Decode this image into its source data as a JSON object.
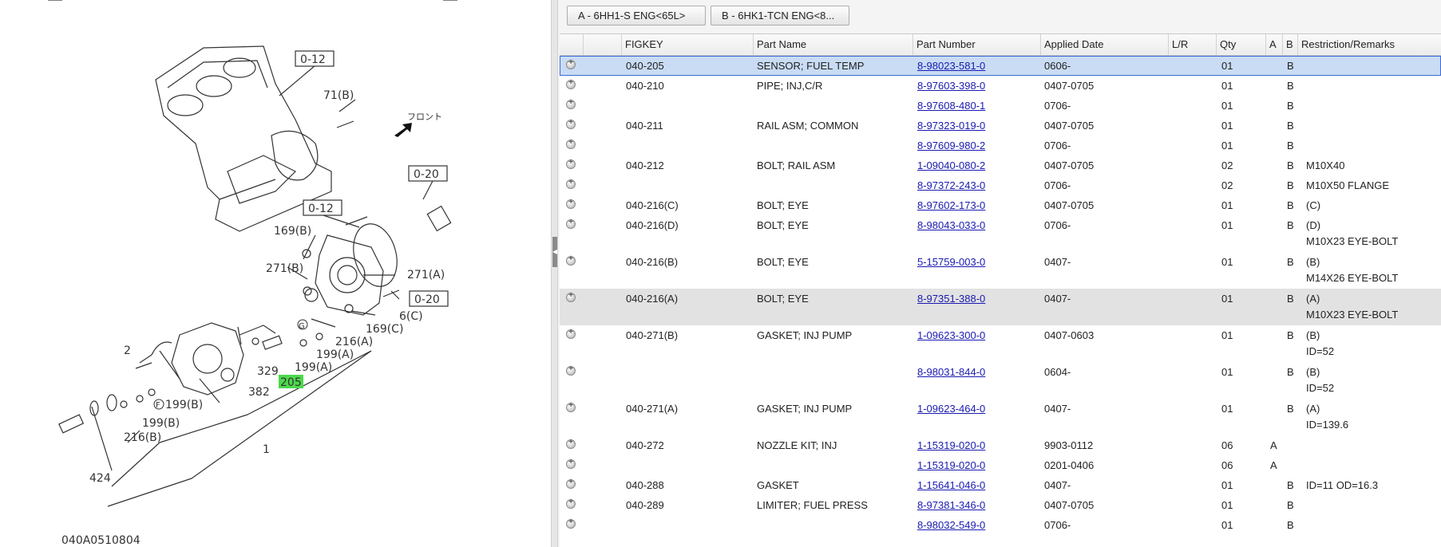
{
  "diagram": {
    "code": "040A0510804",
    "front_label": "フロント",
    "callouts": [
      "0-12",
      "71(B)",
      "0-20",
      "0-12",
      "169(B)",
      "271(B)",
      "271(A)",
      "0-20",
      "6(C)",
      "169(C)",
      "G",
      "216(A)",
      "199(A)",
      "199(A)",
      "2",
      "329",
      "205",
      "382",
      "F",
      "199(B)",
      "199(B)",
      "216(B)",
      "1",
      "424"
    ]
  },
  "variant_buttons": [
    {
      "label": "A - 6HH1-S ENG<65L>"
    },
    {
      "label": "B - 6HK1-TCN ENG<8..."
    }
  ],
  "columns": [
    "",
    "",
    "FIGKEY",
    "Part Name",
    "Part Number",
    "Applied Date",
    "L/R",
    "Qty",
    "A",
    "B",
    "Restriction/Remarks"
  ],
  "rows": [
    {
      "figkey": "040-205",
      "name": "SENSOR; FUEL TEMP",
      "pn": "8-98023-581-0",
      "date": "0606-",
      "lr": "",
      "qty": "01",
      "a": "",
      "b": "B",
      "r1": "",
      "r2": ""
    },
    {
      "figkey": "040-210",
      "name": "PIPE; INJ,C/R",
      "pn": "8-97603-398-0",
      "date": "0407-0705",
      "lr": "",
      "qty": "01",
      "a": "",
      "b": "B",
      "r1": "",
      "r2": ""
    },
    {
      "figkey": "",
      "name": "",
      "pn": "8-97608-480-1",
      "date": "0706-",
      "lr": "",
      "qty": "01",
      "a": "",
      "b": "B",
      "r1": "",
      "r2": ""
    },
    {
      "figkey": "040-211",
      "name": "RAIL ASM; COMMON",
      "pn": "8-97323-019-0",
      "date": "0407-0705",
      "lr": "",
      "qty": "01",
      "a": "",
      "b": "B",
      "r1": "",
      "r2": ""
    },
    {
      "figkey": "",
      "name": "",
      "pn": "8-97609-980-2",
      "date": "0706-",
      "lr": "",
      "qty": "01",
      "a": "",
      "b": "B",
      "r1": "",
      "r2": ""
    },
    {
      "figkey": "040-212",
      "name": "BOLT; RAIL ASM",
      "pn": "1-09040-080-2",
      "date": "0407-0705",
      "lr": "",
      "qty": "02",
      "a": "",
      "b": "B",
      "r1": "M10X40",
      "r2": ""
    },
    {
      "figkey": "",
      "name": "",
      "pn": "8-97372-243-0",
      "date": "0706-",
      "lr": "",
      "qty": "02",
      "a": "",
      "b": "B",
      "r1": "M10X50 FLANGE",
      "r2": ""
    },
    {
      "figkey": "040-216(C)",
      "name": "BOLT; EYE",
      "pn": "8-97602-173-0",
      "date": "0407-0705",
      "lr": "",
      "qty": "01",
      "a": "",
      "b": "B",
      "r1": "(C)",
      "r2": ""
    },
    {
      "figkey": "040-216(D)",
      "name": "BOLT; EYE",
      "pn": "8-98043-033-0",
      "date": "0706-",
      "lr": "",
      "qty": "01",
      "a": "",
      "b": "B",
      "r1": "(D)",
      "r2": "M10X23 EYE-BOLT"
    },
    {
      "figkey": "040-216(B)",
      "name": "BOLT; EYE",
      "pn": "5-15759-003-0",
      "date": "0407-",
      "lr": "",
      "qty": "01",
      "a": "",
      "b": "B",
      "r1": "(B)",
      "r2": "M14X26 EYE-BOLT"
    },
    {
      "figkey": "040-216(A)",
      "name": "BOLT; EYE",
      "pn": "8-97351-388-0",
      "date": "0407-",
      "lr": "",
      "qty": "01",
      "a": "",
      "b": "B",
      "r1": "(A)",
      "r2": "M10X23 EYE-BOLT"
    },
    {
      "figkey": "040-271(B)",
      "name": "GASKET; INJ PUMP",
      "pn": "1-09623-300-0",
      "date": "0407-0603",
      "lr": "",
      "qty": "01",
      "a": "",
      "b": "B",
      "r1": "(B)",
      "r2": "ID=52"
    },
    {
      "figkey": "",
      "name": "",
      "pn": "8-98031-844-0",
      "date": "0604-",
      "lr": "",
      "qty": "01",
      "a": "",
      "b": "B",
      "r1": "(B)",
      "r2": "ID=52"
    },
    {
      "figkey": "040-271(A)",
      "name": "GASKET; INJ PUMP",
      "pn": "1-09623-464-0",
      "date": "0407-",
      "lr": "",
      "qty": "01",
      "a": "",
      "b": "B",
      "r1": "(A)",
      "r2": "ID=139.6"
    },
    {
      "figkey": "040-272",
      "name": "NOZZLE KIT; INJ",
      "pn": "1-15319-020-0",
      "date": "9903-0112",
      "lr": "",
      "qty": "06",
      "a": "A",
      "b": "",
      "r1": "",
      "r2": ""
    },
    {
      "figkey": "",
      "name": "",
      "pn": "1-15319-020-0",
      "date": "0201-0406",
      "lr": "",
      "qty": "06",
      "a": "A",
      "b": "",
      "r1": "",
      "r2": ""
    },
    {
      "figkey": "040-288",
      "name": "GASKET",
      "pn": "1-15641-046-0",
      "date": "0407-",
      "lr": "",
      "qty": "01",
      "a": "",
      "b": "B",
      "r1": "ID=11 OD=16.3",
      "r2": ""
    },
    {
      "figkey": "040-289",
      "name": "LIMITER; FUEL PRESS",
      "pn": "8-97381-346-0",
      "date": "0407-0705",
      "lr": "",
      "qty": "01",
      "a": "",
      "b": "B",
      "r1": "",
      "r2": ""
    },
    {
      "figkey": "",
      "name": "",
      "pn": "8-98032-549-0",
      "date": "0706-",
      "lr": "",
      "qty": "01",
      "a": "",
      "b": "B",
      "r1": "",
      "r2": ""
    }
  ],
  "selected_row": 0,
  "hover_row": 10,
  "highlight_callout": "205",
  "colors": {
    "selected_bg": "#c9dcf4",
    "selected_border": "#3c6bd6",
    "link": "#1a1ab0",
    "callout_highlight": "#4cd94c"
  }
}
